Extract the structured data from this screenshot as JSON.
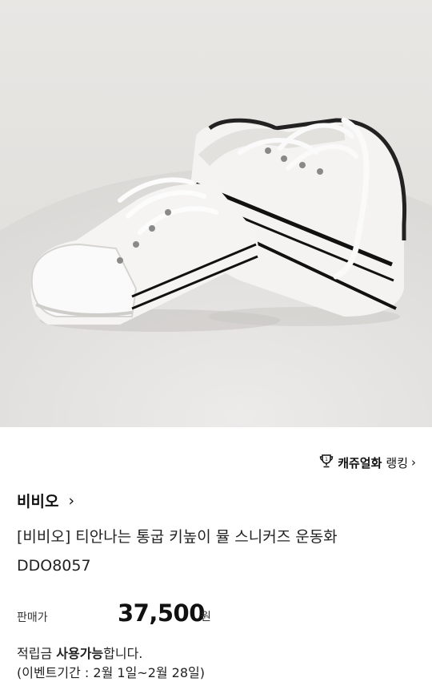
{
  "product_image": {
    "alt": "white platform sneakers"
  },
  "ranking": {
    "category": "캐쥬얼화",
    "label": "랭킹",
    "icon": "trophy-icon"
  },
  "brand": {
    "name": "비비오",
    "icon": "chevron-right-icon"
  },
  "product": {
    "title_line1": "[비비오] 티안나는 통굽 키높이 뮬 스니커즈 운동화",
    "title_line2": "DDO8057"
  },
  "price": {
    "label": "판매가",
    "value": "37,500",
    "unit": "원"
  },
  "points": {
    "prefix": "적립금 ",
    "emphasis": "사용가능",
    "suffix": "합니다.",
    "event_period": "(이벤트기간 : 2월 1일~2월 28일)"
  }
}
